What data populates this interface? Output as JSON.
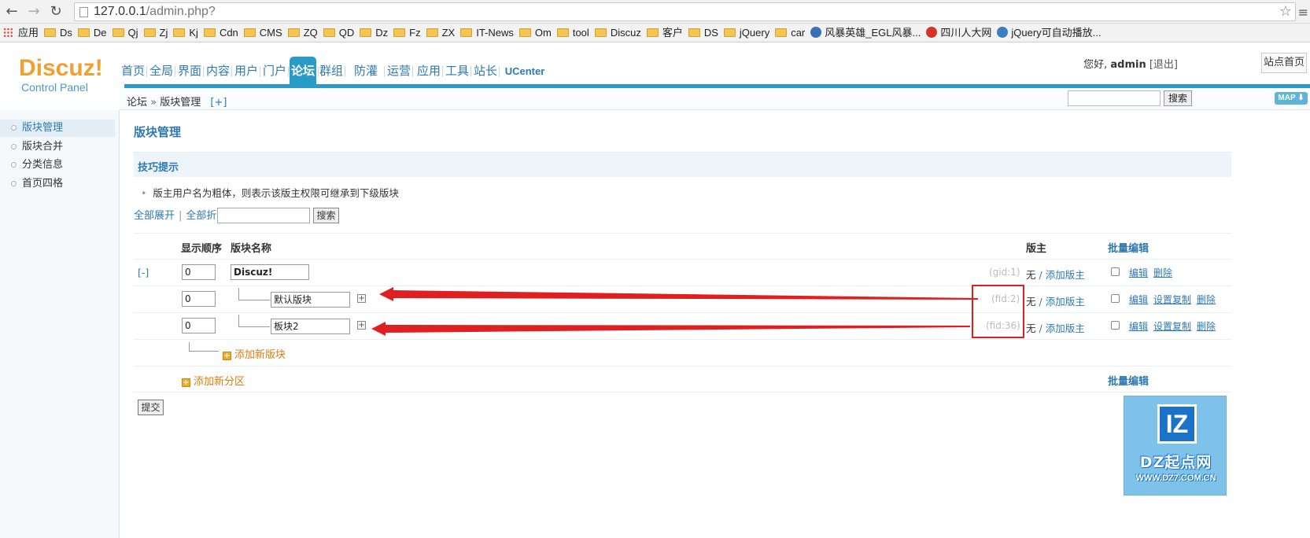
{
  "browser": {
    "url_host": "127.0.0.1",
    "url_path": "/admin.php?",
    "bookmarks": [
      "应用",
      "Ds",
      "De",
      "Qj",
      "Zj",
      "Kj",
      "Cdn",
      "CMS",
      "ZQ",
      "QD",
      "Dz",
      "Fz",
      "ZX",
      "IT-News",
      "Om",
      "tool",
      "Discuz",
      "客户",
      "DS",
      "jQuery",
      "car",
      "风暴英雄_EGL风暴...",
      "四川人大网",
      "jQuery可自动播放..."
    ]
  },
  "header": {
    "logo_main": "Discuz!",
    "logo_sub": "Control Panel",
    "nav": [
      "首页",
      "全局",
      "界面",
      "内容",
      "用户",
      "门户",
      "论坛",
      "群组",
      "防灌水",
      "运营",
      "应用",
      "工具",
      "站长",
      "UCenter"
    ],
    "active_nav": "论坛",
    "greeting": "您好,",
    "username": "admin",
    "logout": "[退出]",
    "home_button": "站点首页"
  },
  "subbar": {
    "crumb_root": "论坛",
    "crumb_sep": "»",
    "crumb_current": "版块管理",
    "crumb_add": "[+]",
    "search_button": "搜索",
    "map_button": "MAP ⬇"
  },
  "sidebar": {
    "items": [
      "版块管理",
      "版块合并",
      "分类信息",
      "首页四格"
    ]
  },
  "main": {
    "title": "版块管理",
    "tips_title": "技巧提示",
    "tip": "版主用户名为粗体，则表示该版主权限可继承到下级版块",
    "expand_all": "全部展开",
    "collapse_all": "全部折叠",
    "filter_button": "搜索",
    "col_order": "显示顺序",
    "col_name": "版块名称",
    "col_moderator": "版主",
    "col_batch": "批量编辑",
    "group": {
      "toggle": "[-]",
      "order": "0",
      "name": "Discuz!",
      "id_label": "(gid:1)",
      "mod_none": "无",
      "mod_sep": " / ",
      "mod_add": "添加版主",
      "edit": "编辑",
      "delete": "删除"
    },
    "forums": [
      {
        "order": "0",
        "name": "默认版块",
        "id_label": "(fid:2)",
        "mod_none": "无",
        "mod_sep": " / ",
        "mod_add": "添加版主",
        "edit": "编辑",
        "copy": "设置复制",
        "delete": "删除"
      },
      {
        "order": "0",
        "name": "板块2",
        "id_label": "(fid:36)",
        "mod_none": "无",
        "mod_sep": " / ",
        "mod_add": "添加版主",
        "edit": "编辑",
        "copy": "设置复制",
        "delete": "删除"
      }
    ],
    "add_forum": "添加新版块",
    "add_group": "添加新分区",
    "batch_bottom": "批量编辑",
    "submit": "提交"
  },
  "watermark": {
    "badge": "IZ",
    "line1": "DZ起点网",
    "line2": "WWW.DZ7.COM.CN"
  },
  "colors": {
    "accent": "#2a9ac9",
    "link": "#2e79b1",
    "annotation": "#e02020",
    "add_orange": "#e07a10"
  }
}
